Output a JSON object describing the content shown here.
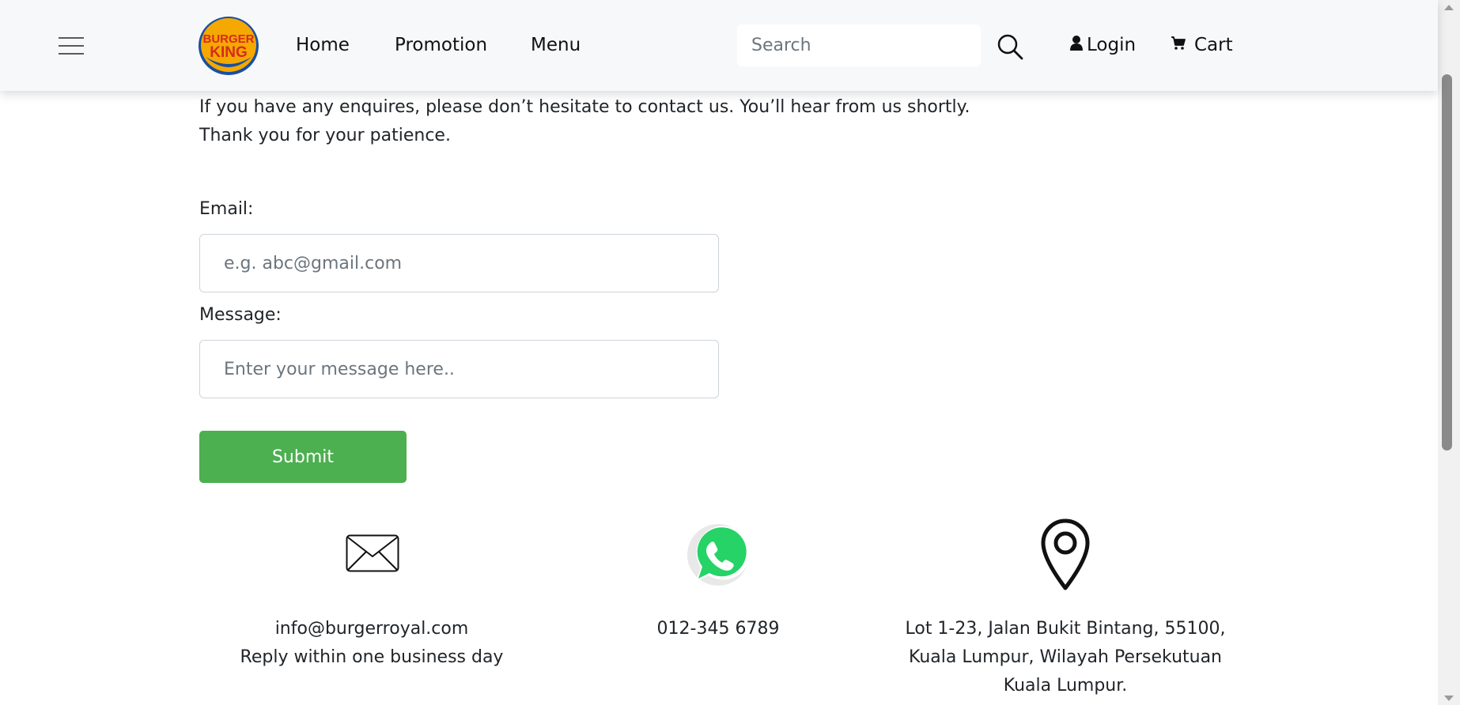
{
  "nav": {
    "menu_icon": "hamburger-menu-icon",
    "logo_text_top": "BURGER",
    "logo_text_bottom": "KING",
    "links": [
      "Home",
      "Promotion",
      "Menu"
    ],
    "search_placeholder": "Search",
    "search_icon": "search-icon",
    "login_label": "Login",
    "login_icon": "user-icon",
    "cart_label": "Cart",
    "cart_icon": "cart-icon"
  },
  "intro": {
    "line1": "If you have any enquires, please don’t hesitate to contact us. You’ll hear from us shortly.",
    "line2": "Thank you for your patience."
  },
  "form": {
    "email_label": "Email:",
    "email_placeholder": "e.g. abc@gmail.com",
    "message_label": "Message:",
    "message_placeholder": "Enter your message here..",
    "submit_label": "Submit"
  },
  "contact": {
    "email": {
      "icon": "envelope-icon",
      "line1": "info@burgerroyal.com",
      "line2": "Reply within one business day"
    },
    "phone": {
      "icon": "whatsapp-icon",
      "line1": "012-345 6789"
    },
    "address": {
      "icon": "location-pin-icon",
      "line1": "Lot 1-23, Jalan Bukit Bintang, 55100,",
      "line2": "Kuala Lumpur, Wilayah Persekutuan",
      "line3": "Kuala Lumpur."
    }
  },
  "colors": {
    "submit": "#4caf50",
    "navbar_bg": "#f7f8fa",
    "whatsapp": "#25d366",
    "logo_red": "#d52b1e",
    "logo_orange": "#f5a800",
    "logo_blue": "#1a4fa0"
  }
}
